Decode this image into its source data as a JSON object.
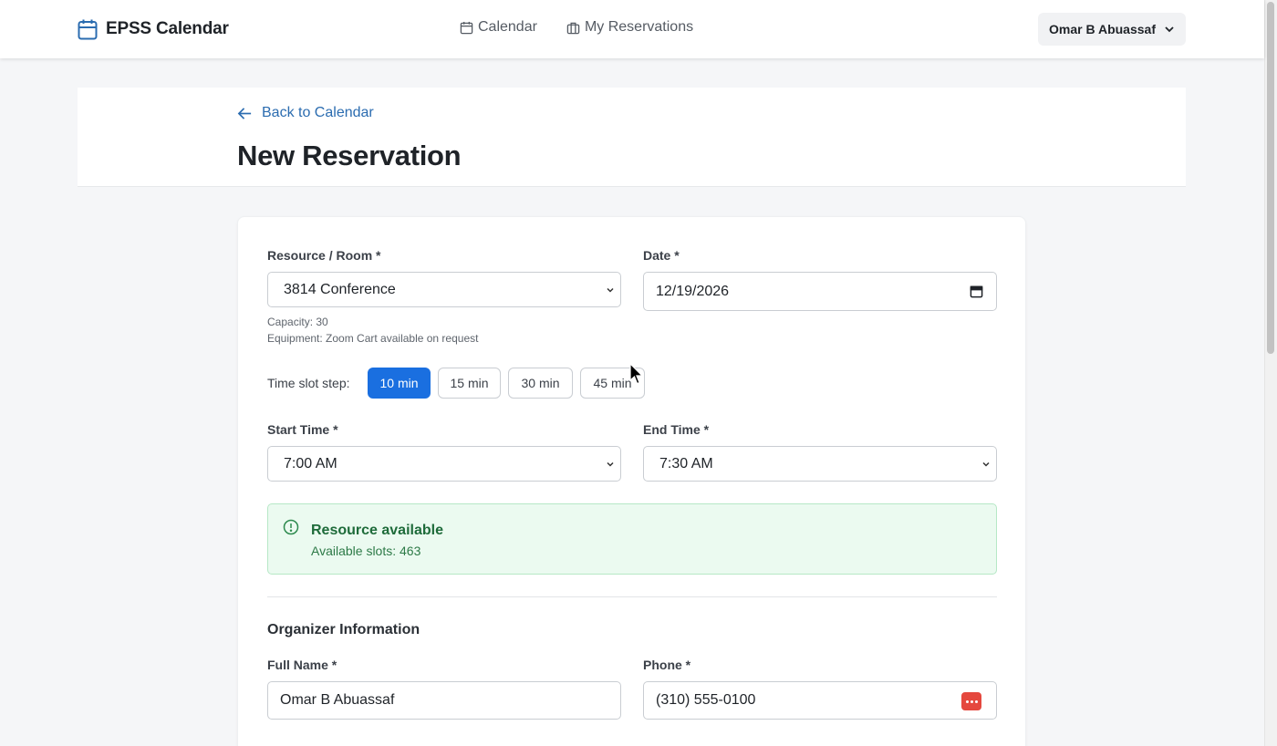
{
  "app": {
    "brand": "EPSS Calendar",
    "nav": [
      {
        "label": "Calendar",
        "icon": "calendar-icon"
      },
      {
        "label": "My Reservations",
        "icon": "briefcase-icon"
      }
    ],
    "user": "Omar B Abuassaf"
  },
  "header": {
    "back_label": "Back to Calendar",
    "title": "New Reservation"
  },
  "form": {
    "resource_label": "Resource / Room *",
    "resource_value": "3814 Conference",
    "capacity_text": "Capacity: 30",
    "equipment_text": "Equipment: Zoom Cart available on request",
    "date_label": "Date *",
    "date_value": "12/19/2026",
    "step_label": "Time slot step:",
    "steps": [
      {
        "label": "10 min",
        "active": true
      },
      {
        "label": "15 min",
        "active": false
      },
      {
        "label": "30 min",
        "active": false
      },
      {
        "label": "45 min",
        "active": false
      }
    ],
    "start_label": "Start Time *",
    "start_value": "7:00 AM",
    "end_label": "End Time *",
    "end_value": "7:30 AM",
    "availability_title": "Resource available",
    "availability_text": "Available slots: 463",
    "organizer_title": "Organizer Information",
    "fullname_label": "Full Name *",
    "fullname_value": "Omar B Abuassaf",
    "phone_label": "Phone *",
    "phone_value": "(310) 555-0100"
  },
  "colors": {
    "primary": "#1a6fe0",
    "link": "#2b6cb0",
    "success_bg": "#ebfaf0",
    "success_text": "#1e6b3a"
  }
}
